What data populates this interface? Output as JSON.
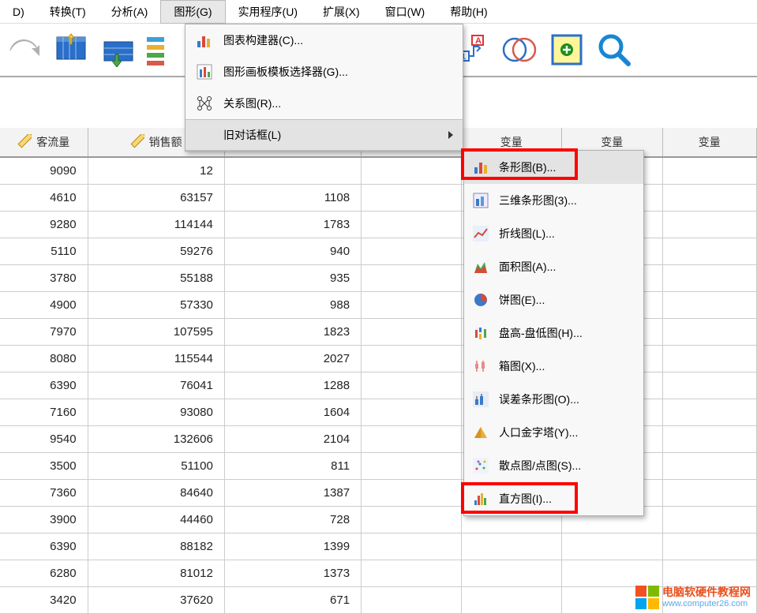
{
  "menubar": {
    "items": [
      {
        "label": "D)"
      },
      {
        "label": "转换(T)"
      },
      {
        "label": "分析(A)"
      },
      {
        "label": "图形(G)"
      },
      {
        "label": "实用程序(U)"
      },
      {
        "label": "扩展(X)"
      },
      {
        "label": "窗口(W)"
      },
      {
        "label": "帮助(H)"
      }
    ]
  },
  "graph_menu": {
    "items": [
      {
        "label": "图表构建器(C)..."
      },
      {
        "label": "图形画板模板选择器(G)..."
      },
      {
        "label": "关系图(R)..."
      },
      {
        "label": "旧对话框(L)"
      }
    ]
  },
  "legacy_submenu": {
    "items": [
      {
        "label": "条形图(B)..."
      },
      {
        "label": "三维条形图(3)..."
      },
      {
        "label": "折线图(L)..."
      },
      {
        "label": "面积图(A)..."
      },
      {
        "label": "饼图(E)..."
      },
      {
        "label": "盘高-盘低图(H)..."
      },
      {
        "label": "箱图(X)..."
      },
      {
        "label": "误差条形图(O)..."
      },
      {
        "label": "人口金字塔(Y)..."
      },
      {
        "label": "散点图/点图(S)..."
      },
      {
        "label": "直方图(I)..."
      }
    ]
  },
  "grid": {
    "headers": [
      "客流量",
      "销售额",
      "",
      "变量",
      "变量",
      "变量"
    ],
    "rows": [
      [
        "9090",
        "12",
        "",
        "",
        "",
        "",
        ""
      ],
      [
        "4610",
        "63157",
        "1108",
        "",
        "",
        "",
        ""
      ],
      [
        "9280",
        "114144",
        "1783",
        "",
        "",
        "",
        ""
      ],
      [
        "5110",
        "59276",
        "940",
        "",
        "",
        "",
        ""
      ],
      [
        "3780",
        "55188",
        "935",
        "",
        "",
        "",
        ""
      ],
      [
        "4900",
        "57330",
        "988",
        "",
        "",
        "",
        ""
      ],
      [
        "7970",
        "107595",
        "1823",
        "",
        "",
        "",
        ""
      ],
      [
        "8080",
        "115544",
        "2027",
        "",
        "",
        "",
        ""
      ],
      [
        "6390",
        "76041",
        "1288",
        "",
        "",
        "",
        ""
      ],
      [
        "7160",
        "93080",
        "1604",
        "",
        "",
        "",
        ""
      ],
      [
        "9540",
        "132606",
        "2104",
        "",
        "",
        "",
        ""
      ],
      [
        "3500",
        "51100",
        "811",
        "",
        "",
        "",
        ""
      ],
      [
        "7360",
        "84640",
        "1387",
        "",
        "",
        "",
        ""
      ],
      [
        "3900",
        "44460",
        "728",
        "",
        "",
        "",
        ""
      ],
      [
        "6390",
        "88182",
        "1399",
        "",
        "",
        "",
        ""
      ],
      [
        "6280",
        "81012",
        "1373",
        "",
        "",
        "",
        ""
      ],
      [
        "3420",
        "37620",
        "671",
        "",
        "",
        "",
        ""
      ]
    ]
  },
  "watermark": {
    "title": "电脑软硬件教程网",
    "url": "www.computer26.com"
  }
}
